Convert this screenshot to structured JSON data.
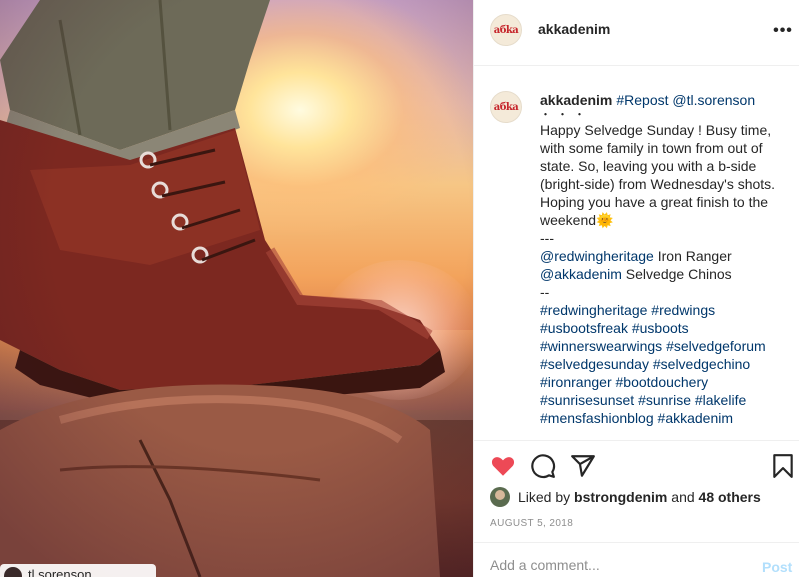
{
  "photo": {
    "credit_username": "tl.sorenson"
  },
  "header": {
    "logo_text": "aбka",
    "username": "akkadenim",
    "more_icon": "more-options-icon"
  },
  "caption": {
    "username": "akkadenim",
    "repost_tag": "#Repost",
    "repost_mention": "@tl.sorenson",
    "dots": "・・・",
    "line1": "Happy Selvedge Sunday ! Busy time,",
    "line2": "with some family in town from out of",
    "line3": "state. So, leaving you with a b-side",
    "line4": "(bright-side) from Wednesday's shots.",
    "line5": "Hoping you have a great finish to the",
    "line6": "weekend🌞",
    "sep1": "---",
    "mention1": "@redwingheritage",
    "mention1_text": " Iron Ranger",
    "mention2": "@akkadenim",
    "mention2_text": " Selvedge Chinos",
    "sep2": "--",
    "hashtags": [
      [
        "#redwingheritage",
        "#redwings"
      ],
      [
        "#usbootsfreak",
        "#usboots"
      ],
      [
        "#winnerswearwings",
        "#selvedgeforum"
      ],
      [
        "#selvedgesunday",
        "#selvedgechino"
      ],
      [
        "#ironranger",
        "#bootdouchery"
      ],
      [
        "#sunrisesunset",
        "#sunrise",
        "#lakelife"
      ],
      [
        "#mensfashionblog",
        "#akkadenim"
      ]
    ]
  },
  "actions": {
    "like_icon": "heart-icon",
    "comment_icon": "comment-icon",
    "share_icon": "share-icon",
    "save_icon": "bookmark-icon",
    "heart_color": "#ed4956"
  },
  "likes": {
    "prefix": "Liked by",
    "liker": "bstrongdenim",
    "and": "and",
    "others": "48 others"
  },
  "date": "AUGUST 5, 2018",
  "comment": {
    "placeholder": "Add a comment...",
    "post_label": "Post"
  }
}
